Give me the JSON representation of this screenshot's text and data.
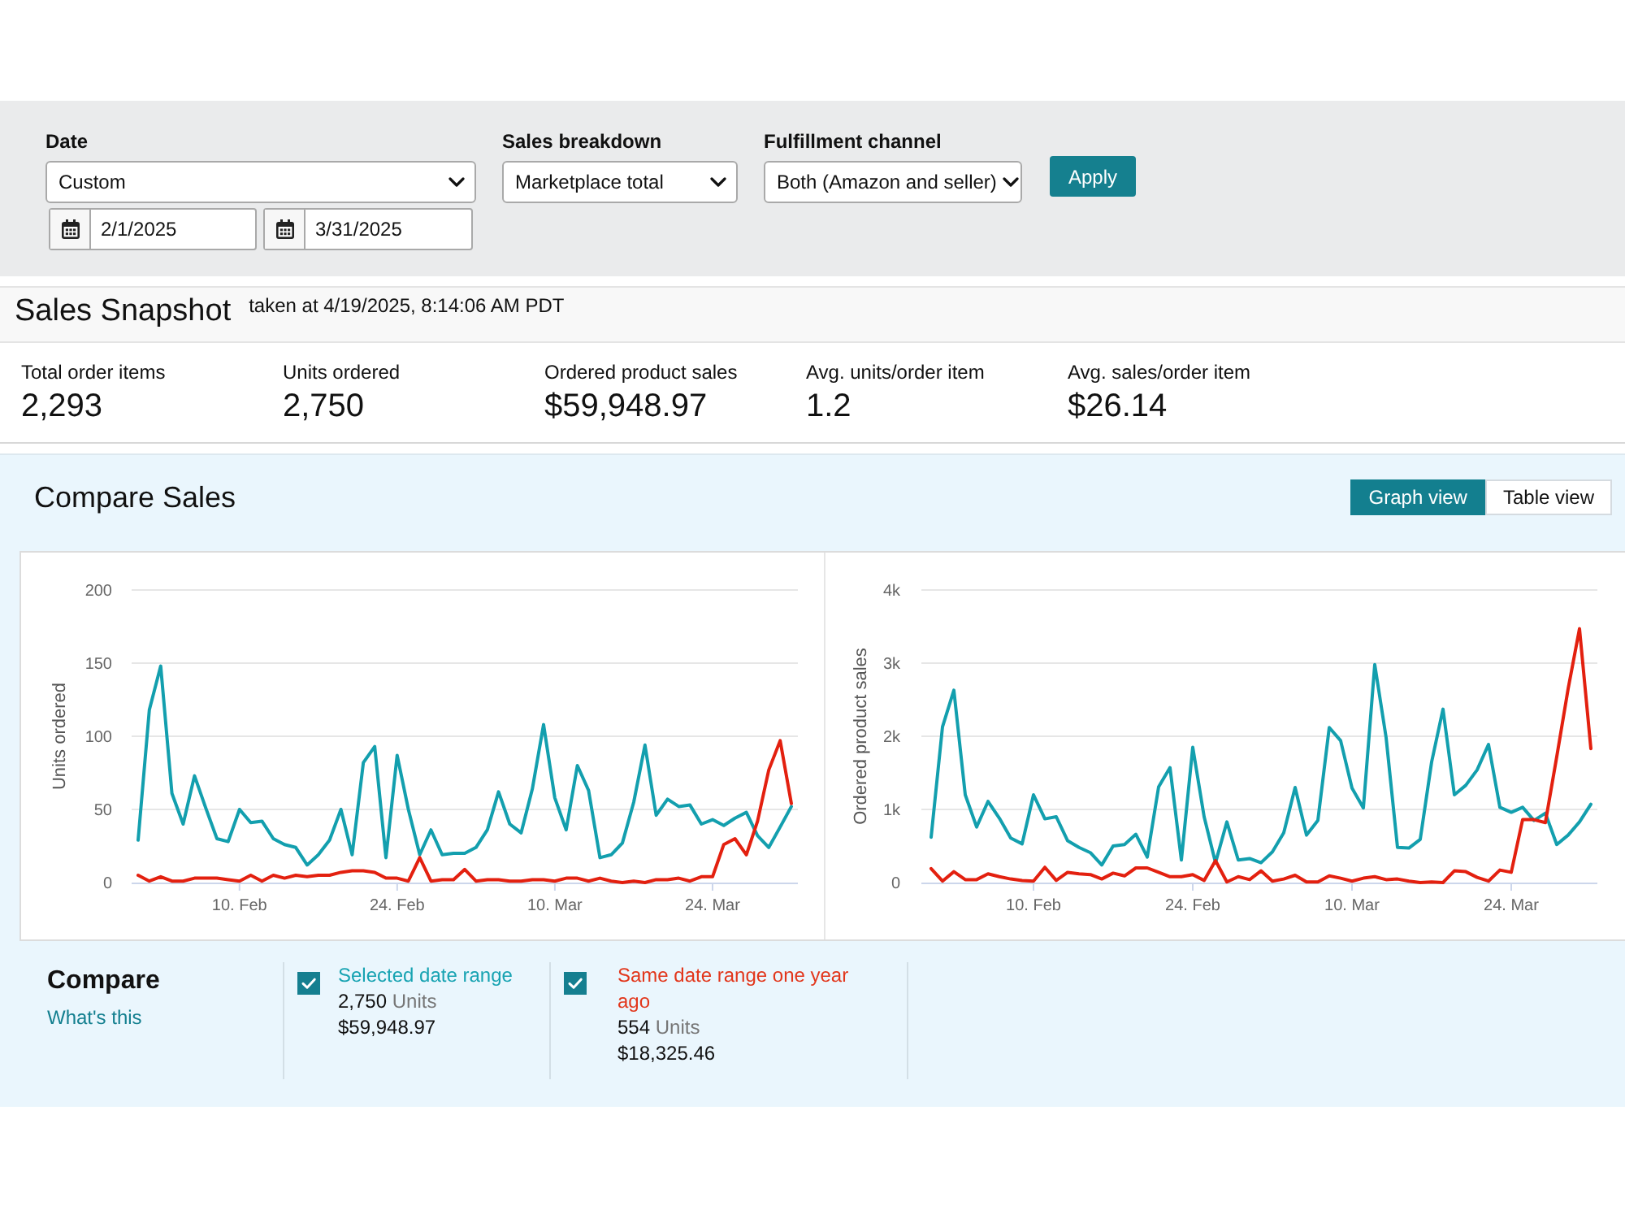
{
  "filters": {
    "fields": [
      {
        "kind": "date",
        "label": "Date",
        "value": "Custom",
        "start": "2/1/2025",
        "end": "3/31/2025"
      },
      {
        "kind": "select",
        "label": "Sales breakdown",
        "value": "Marketplace total"
      },
      {
        "kind": "select",
        "label": "Fulfillment channel",
        "value": "Both (Amazon and seller)"
      }
    ],
    "apply_button": "Apply"
  },
  "snapshot": {
    "title": "Sales Snapshot",
    "taken_at": "taken at 4/19/2025, 8:14:06 AM PDT",
    "metrics": [
      {
        "label": "Total order items",
        "value": "2,293"
      },
      {
        "label": "Units ordered",
        "value": "2,750"
      },
      {
        "label": "Ordered product sales",
        "value": "$59,948.97"
      },
      {
        "label": "Avg. units/order item",
        "value": "1.2"
      },
      {
        "label": "Avg. sales/order item",
        "value": "$26.14"
      }
    ]
  },
  "compare_sales": {
    "title": "Compare Sales",
    "views": [
      {
        "label": "Graph view",
        "selected": true
      },
      {
        "label": "Table view",
        "selected": false
      }
    ],
    "charts": [
      {
        "chart_data": {
          "type": "line",
          "ylabel": "Units ordered",
          "grid": true,
          "categories": [
            null,
            null,
            null,
            null,
            null,
            null,
            null,
            null,
            null,
            "10. Feb",
            null,
            null,
            null,
            null,
            null,
            null,
            null,
            null,
            null,
            null,
            null,
            null,
            null,
            "24. Feb",
            null,
            null,
            null,
            null,
            null,
            null,
            null,
            null,
            null,
            null,
            null,
            null,
            null,
            "10. Mar",
            null,
            null,
            null,
            null,
            null,
            null,
            null,
            null,
            null,
            null,
            null,
            null,
            null,
            "24. Mar",
            null,
            null,
            null,
            null,
            null,
            null,
            null
          ],
          "series": [
            {
              "color": "#139fae",
              "values": [
                29,
                118,
                148,
                61,
                40,
                73,
                51,
                30,
                28,
                50,
                41,
                42,
                30,
                26,
                24,
                12,
                19,
                29,
                50,
                19,
                82,
                93,
                17,
                87,
                50,
                19,
                36,
                19,
                20,
                20,
                24,
                36,
                62,
                40,
                34,
                64,
                108,
                58,
                36,
                80,
                63,
                17,
                19,
                27,
                55,
                94,
                46,
                57,
                52,
                53,
                40,
                43,
                39,
                44,
                48,
                32,
                24,
                38,
                52
              ]
            },
            {
              "color": "#e3200f",
              "values": [
                5,
                1,
                4,
                1,
                1,
                3,
                3,
                3,
                2,
                1,
                5,
                1,
                5,
                3,
                5,
                4,
                5,
                5,
                7,
                8,
                8,
                7,
                3,
                3,
                1,
                17,
                1,
                2,
                2,
                9,
                1,
                2,
                2,
                1,
                1,
                2,
                2,
                1,
                3,
                3,
                1,
                3,
                1,
                0,
                1,
                0,
                2,
                2,
                3,
                1,
                4,
                4,
                26,
                30,
                19,
                42,
                77,
                97,
                54
              ]
            }
          ],
          "ylim": [
            0,
            200
          ],
          "yticks": [
            0,
            50,
            100,
            150,
            200
          ]
        }
      },
      {
        "chart_data": {
          "type": "line",
          "ylabel": "Ordered product sales",
          "grid": true,
          "categories": [
            null,
            null,
            null,
            null,
            null,
            null,
            null,
            null,
            null,
            "10. Feb",
            null,
            null,
            null,
            null,
            null,
            null,
            null,
            null,
            null,
            null,
            null,
            null,
            null,
            "24. Feb",
            null,
            null,
            null,
            null,
            null,
            null,
            null,
            null,
            null,
            null,
            null,
            null,
            null,
            "10. Mar",
            null,
            null,
            null,
            null,
            null,
            null,
            null,
            null,
            null,
            null,
            null,
            null,
            null,
            "24. Mar",
            null,
            null,
            null,
            null,
            null,
            null,
            null
          ],
          "series": [
            {
              "color": "#139fae",
              "values": [
                620,
                2130,
                2630,
                1200,
                760,
                1110,
                880,
                610,
                530,
                1200,
                870,
                900,
                570,
                480,
                410,
                240,
                500,
                520,
                660,
                350,
                1310,
                1570,
                310,
                1850,
                900,
                270,
                830,
                310,
                330,
                270,
                420,
                680,
                1300,
                650,
                850,
                2120,
                1940,
                1290,
                1020,
                2980,
                1980,
                480,
                470,
                590,
                1650,
                2370,
                1200,
                1330,
                1540,
                1890,
                1030,
                960,
                1030,
                850,
                950,
                520,
                650,
                830,
                1070
              ]
            },
            {
              "color": "#e3200f",
              "values": [
                190,
                20,
                150,
                40,
                40,
                120,
                80,
                50,
                30,
                20,
                210,
                30,
                140,
                120,
                110,
                50,
                130,
                90,
                200,
                200,
                140,
                80,
                80,
                110,
                30,
                300,
                10,
                80,
                40,
                160,
                20,
                50,
                100,
                10,
                10,
                90,
                60,
                20,
                60,
                80,
                40,
                50,
                20,
                0,
                10,
                0,
                160,
                150,
                70,
                20,
                170,
                140,
                860,
                860,
                820,
                1720,
                2650,
                3470,
                1830
              ]
            }
          ],
          "ylim": [
            0,
            4000
          ],
          "yticks": [
            0,
            {
              "value": 1000,
              "label": "1k"
            },
            {
              "value": 2000,
              "label": "2k"
            },
            {
              "value": 3000,
              "label": "3k"
            },
            {
              "value": 4000,
              "label": "4k"
            }
          ]
        }
      }
    ],
    "legend": {
      "title": "Compare",
      "link": "What's this",
      "items": [
        {
          "label": "Selected date range",
          "color": "#17a3b2",
          "checked": true,
          "units": "2,750",
          "units_label": "Units",
          "sales": "$59,948.97"
        },
        {
          "label": "Same date range one year ago",
          "color": "#e2361b",
          "checked": true,
          "units": "554",
          "units_label": "Units",
          "sales": "$18,325.46"
        }
      ]
    }
  }
}
